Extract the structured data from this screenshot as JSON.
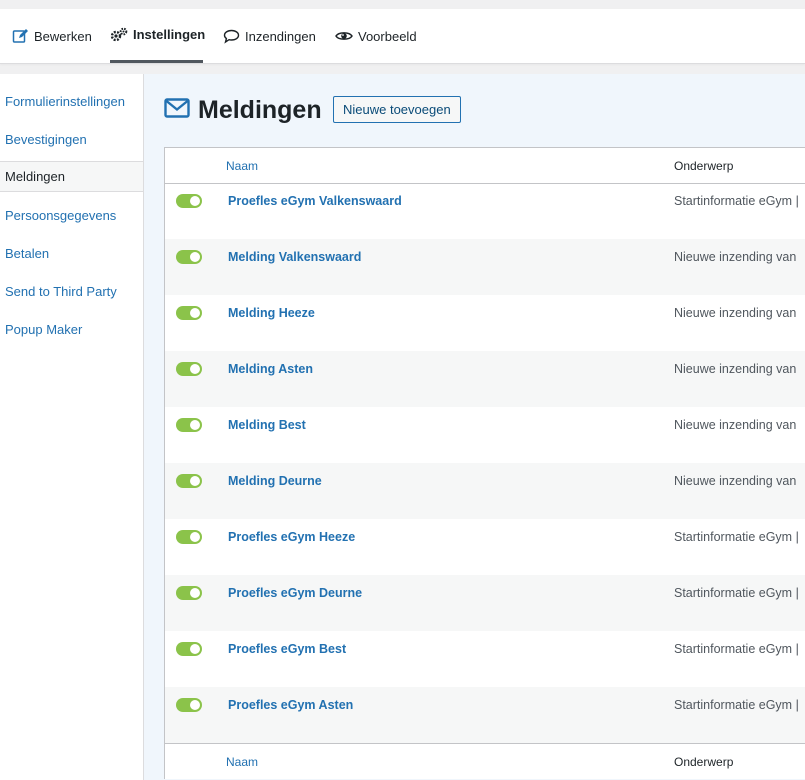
{
  "toolbar": {
    "tabs": [
      {
        "label": "Bewerken",
        "icon": "edit-icon"
      },
      {
        "label": "Instellingen",
        "icon": "gears-icon",
        "active": true
      },
      {
        "label": "Inzendingen",
        "icon": "speech-bubble-icon"
      },
      {
        "label": "Voorbeeld",
        "icon": "eye-icon"
      }
    ]
  },
  "sidebar": {
    "items": [
      {
        "label": "Formulierinstellingen"
      },
      {
        "label": "Bevestigingen"
      },
      {
        "label": "Meldingen",
        "active": true
      },
      {
        "label": "Persoonsgegevens"
      },
      {
        "label": "Betalen"
      },
      {
        "label": "Send to Third Party"
      },
      {
        "label": "Popup Maker"
      }
    ]
  },
  "main": {
    "title": "Meldingen",
    "title_icon": "envelope-icon",
    "add_button": "Nieuwe toevoegen",
    "columns": {
      "name": "Naam",
      "subject": "Onderwerp"
    },
    "rows": [
      {
        "name": "Proefles eGym Valkenswaard",
        "subject": "Startinformatie eGym |",
        "active": true
      },
      {
        "name": "Melding Valkenswaard",
        "subject": "Nieuwe inzending van",
        "active": true
      },
      {
        "name": "Melding Heeze",
        "subject": "Nieuwe inzending van",
        "active": true
      },
      {
        "name": "Melding Asten",
        "subject": "Nieuwe inzending van",
        "active": true
      },
      {
        "name": "Melding Best",
        "subject": "Nieuwe inzending van",
        "active": true
      },
      {
        "name": "Melding Deurne",
        "subject": "Nieuwe inzending van",
        "active": true
      },
      {
        "name": "Proefles eGym Heeze",
        "subject": "Startinformatie eGym |",
        "active": true
      },
      {
        "name": "Proefles eGym Deurne",
        "subject": "Startinformatie eGym |",
        "active": true
      },
      {
        "name": "Proefles eGym Best",
        "subject": "Startinformatie eGym |",
        "active": true
      },
      {
        "name": "Proefles eGym Asten",
        "subject": "Startinformatie eGym |",
        "active": true
      }
    ]
  },
  "colors": {
    "link": "#2271b1",
    "toggle_on": "#8bc34a",
    "main_bg": "#f0f6fc"
  }
}
